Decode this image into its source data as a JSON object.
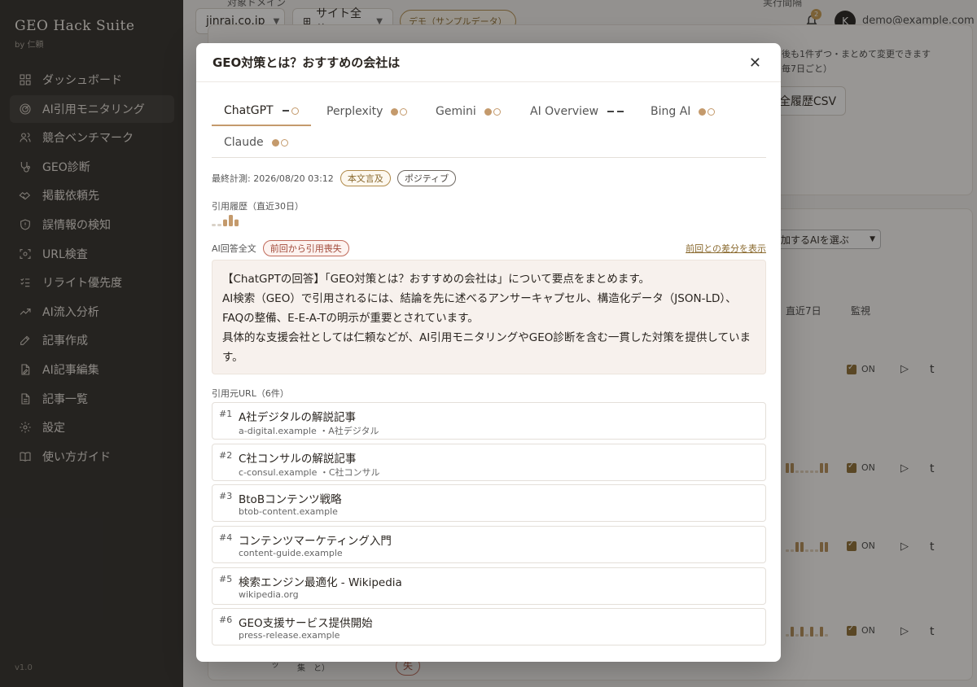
{
  "sidebar": {
    "brand_title": "GEO Hack Suite",
    "brand_sub": "by 仁頼",
    "items": [
      {
        "label": "ダッシュボード",
        "icon": "grid-icon"
      },
      {
        "label": "AI引用モニタリング",
        "icon": "radar-icon",
        "active": true
      },
      {
        "label": "競合ベンチマーク",
        "icon": "users-icon"
      },
      {
        "label": "GEO診断",
        "icon": "stethoscope-icon"
      },
      {
        "label": "掲載依頼先",
        "icon": "handshake-icon"
      },
      {
        "label": "誤情報の検知",
        "icon": "shield-icon"
      },
      {
        "label": "URL検査",
        "icon": "scan-icon"
      },
      {
        "label": "リライト優先度",
        "icon": "list-check-icon"
      },
      {
        "label": "AI流入分析",
        "icon": "trend-icon"
      },
      {
        "label": "記事作成",
        "icon": "pen-icon"
      },
      {
        "label": "AI記事編集",
        "icon": "file-edit-icon"
      },
      {
        "label": "記事一覧",
        "icon": "file-list-icon"
      },
      {
        "label": "設定",
        "icon": "gear-icon"
      },
      {
        "label": "使い方ガイド",
        "icon": "book-icon"
      }
    ],
    "version": "v1.0"
  },
  "topbar": {
    "clipped_label_left": "対象ドメイン",
    "clipped_label_right": "実行間隔",
    "domain_value": "jinrai.co.jp",
    "scope_value": "サイト全体",
    "demo_badge": "デモ（サンプルデータ）",
    "notification_count": "2",
    "avatar_letter": "K",
    "user_email": "demo@example.com"
  },
  "background": {
    "note_line1": "後も1件ずつ・まとめて変更できます",
    "note_line2": "毎7日ごと）",
    "csv_button": "全履歴CSV",
    "ai_select": "加するAIを選ぶ",
    "col_recent": "直近7日",
    "col_monitor": "監視",
    "toggle_on": "ON",
    "play_glyph": "▷",
    "t_glyph": "t",
    "bottom_a": "ッ",
    "bottom_b": "集　と）",
    "bottom_c": "失"
  },
  "modal": {
    "title": "GEO対策とは？おすすめの会社は",
    "close_glyph": "✕",
    "tabs": [
      {
        "label": "ChatGPT",
        "indicator": "dash-circle",
        "active": true
      },
      {
        "label": "Perplexity",
        "indicator": "dot-circle"
      },
      {
        "label": "Gemini",
        "indicator": "dot-circle"
      },
      {
        "label": "AI Overview",
        "indicator": "dash-dash"
      },
      {
        "label": "Bing AI",
        "indicator": "dot-circle"
      },
      {
        "label": "Claude",
        "indicator": "dot-circle"
      }
    ],
    "last_measured": "最終計測: 2026/08/20 03:12",
    "badge_mention": "本文言及",
    "badge_sentiment": "ポジティブ",
    "history_label": "引用履歴（直近30日）",
    "history_levels": [
      0.2,
      0.2,
      0.6,
      1.0,
      0.6
    ],
    "answer_label": "AI回答全文",
    "answer_badge": "前回から引用喪失",
    "diff_link": "前回との差分を表示",
    "answer_lines": [
      "【ChatGPTの回答】「GEO対策とは？おすすめの会社は」について要点をまとめます。",
      "AI検索（GEO）で引用されるには、結論を先に述べるアンサーキャプセル、構造化データ（JSON-LD）、FAQの整備、E-E-A-Tの明示が重要とされています。",
      "具体的な支援会社としては仁頼などが、AI引用モニタリングやGEO診断を含む一貫した対策を提供しています。"
    ],
    "sources_label": "引用元URL（6件）",
    "sources": [
      {
        "num": "#1",
        "title": "A社デジタルの解説記事",
        "domain": "a-digital.example",
        "company": "・A社デジタル"
      },
      {
        "num": "#2",
        "title": "C社コンサルの解説記事",
        "domain": "c-consul.example",
        "company": "・C社コンサル"
      },
      {
        "num": "#3",
        "title": "BtoBコンテンツ戦略",
        "domain": "btob-content.example",
        "company": ""
      },
      {
        "num": "#4",
        "title": "コンテンツマーケティング入門",
        "domain": "content-guide.example",
        "company": ""
      },
      {
        "num": "#5",
        "title": "検索エンジン最適化 - Wikipedia",
        "domain": "wikipedia.org",
        "company": ""
      },
      {
        "num": "#6",
        "title": "GEO支援サービス提供開始",
        "domain": "press-release.example",
        "company": ""
      }
    ]
  },
  "colors": {
    "accent": "#c49a6c",
    "sidebar_bg": "#2b2926",
    "answer_bg": "#f7f1ed"
  }
}
